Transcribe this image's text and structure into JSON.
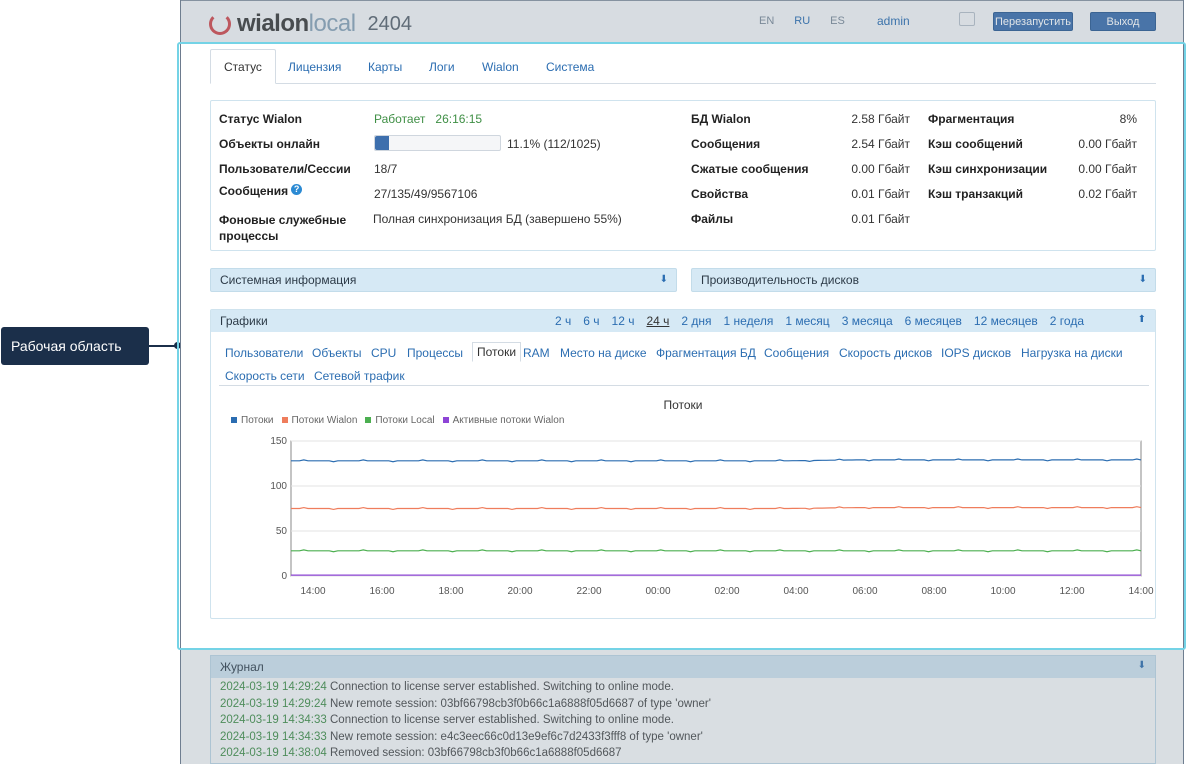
{
  "callout": {
    "text": "Рабочая область"
  },
  "header": {
    "brand": "wialon",
    "brand_suffix": "local",
    "version": "2404",
    "languages": [
      {
        "code": "EN",
        "active": false
      },
      {
        "code": "RU",
        "active": true
      },
      {
        "code": "ES",
        "active": false
      }
    ],
    "user": "admin",
    "restart_label": "Перезапустить",
    "exit_label": "Выход"
  },
  "tabs": [
    {
      "label": "Статус",
      "active": true
    },
    {
      "label": "Лицензия"
    },
    {
      "label": "Карты"
    },
    {
      "label": "Логи"
    },
    {
      "label": "Wialon"
    },
    {
      "label": "Система"
    }
  ],
  "status": {
    "left": [
      {
        "label": "Статус Wialon",
        "value": "Работает",
        "extra": "26:16:15"
      },
      {
        "label": "Объекты онлайн",
        "percent": "11.1%",
        "count": "(112/1025)",
        "progress": 0.111
      },
      {
        "label": "Пользователи/Сессии",
        "value": "18/7"
      },
      {
        "label": "Сообщения",
        "value": "27/135/49/9567106",
        "help": "?"
      },
      {
        "label": "Фоновые служебные процессы",
        "value": "Полная синхронизация БД (завершено 55%)"
      }
    ],
    "middle": [
      {
        "label": "БД Wialon",
        "value": "2.58 Гбайт"
      },
      {
        "label": "Сообщения",
        "value": "2.54 Гбайт"
      },
      {
        "label": "Сжатые сообщения",
        "value": "0.00 Гбайт"
      },
      {
        "label": "Свойства",
        "value": "0.01 Гбайт"
      },
      {
        "label": "Файлы",
        "value": "0.01 Гбайт"
      }
    ],
    "right": [
      {
        "label": "Фрагментация",
        "value": "8%"
      },
      {
        "label": "Кэш сообщений",
        "value": "0.00 Гбайт"
      },
      {
        "label": "Кэш синхронизации",
        "value": "0.00 Гбайт"
      },
      {
        "label": "Кэш транзакций",
        "value": "0.02 Гбайт"
      }
    ]
  },
  "sections": {
    "sysinfo": "Системная информация",
    "disks": "Производительность дисков",
    "charts": "Графики",
    "journal": "Журнал"
  },
  "periods": [
    {
      "label": "2 ч"
    },
    {
      "label": "6 ч"
    },
    {
      "label": "12 ч"
    },
    {
      "label": "24 ч",
      "active": true
    },
    {
      "label": "2 дня"
    },
    {
      "label": "1 неделя"
    },
    {
      "label": "1 месяц"
    },
    {
      "label": "3 месяца"
    },
    {
      "label": "6 месяцев"
    },
    {
      "label": "12 месяцев"
    },
    {
      "label": "2 года"
    }
  ],
  "chart_tabs": [
    {
      "label": "Пользователи"
    },
    {
      "label": "Объекты"
    },
    {
      "label": "CPU"
    },
    {
      "label": "Процессы"
    },
    {
      "label": "Потоки",
      "active": true
    },
    {
      "label": "RAM"
    },
    {
      "label": "Место на диске"
    },
    {
      "label": "Фрагментация БД"
    },
    {
      "label": "Сообщения"
    },
    {
      "label": "Скорость дисков"
    },
    {
      "label": "IOPS дисков"
    },
    {
      "label": "Нагрузка на диски"
    },
    {
      "label": "Скорость сети"
    },
    {
      "label": "Сетевой трафик"
    }
  ],
  "chart_data": {
    "type": "line",
    "title": "Потоки",
    "x": [
      "14:00",
      "16:00",
      "18:00",
      "20:00",
      "22:00",
      "00:00",
      "02:00",
      "04:00",
      "06:00",
      "08:00",
      "10:00",
      "12:00",
      "14:00"
    ],
    "ylim": [
      0,
      150
    ],
    "yticks": [
      0,
      50,
      100,
      150
    ],
    "grid": true,
    "legend_position": "top-left",
    "series": [
      {
        "name": "Потоки",
        "color": "#2b6db1",
        "values": [
          128,
          128,
          128,
          128,
          128,
          128,
          128,
          128,
          129,
          129,
          129,
          129,
          129
        ]
      },
      {
        "name": "Потоки Wialon",
        "color": "#ef7d5c",
        "values": [
          75,
          75,
          75,
          75,
          75,
          75,
          75,
          75,
          76,
          76,
          76,
          76,
          76
        ]
      },
      {
        "name": "Потоки Local",
        "color": "#4caf50",
        "values": [
          28,
          28,
          28,
          28,
          28,
          28,
          28,
          28,
          28,
          28,
          28,
          28,
          28
        ]
      },
      {
        "name": "Активные потоки Wialon",
        "color": "#8e44d6",
        "values": [
          1,
          1,
          1,
          1,
          1,
          1,
          1,
          1,
          1,
          1,
          1,
          1,
          1
        ]
      }
    ]
  },
  "journal": [
    {
      "ts": "2024-03-19 14:29:24",
      "text": " Connection to license server established. Switching to online mode."
    },
    {
      "ts": "2024-03-19 14:29:24",
      "text": " New remote session: 03bf66798cb3f0b66c1a6888f05d6687 of type 'owner'"
    },
    {
      "ts": "2024-03-19 14:34:33",
      "text": " Connection to license server established. Switching to online mode."
    },
    {
      "ts": "2024-03-19 14:34:33",
      "text": " New remote session: e4c3eec66c0d13e9ef6c7d2433f3fff8 of type 'owner'"
    },
    {
      "ts": "2024-03-19 14:38:04",
      "text": " Removed session: 03bf66798cb3f0b66c1a6888f05d6687"
    }
  ]
}
